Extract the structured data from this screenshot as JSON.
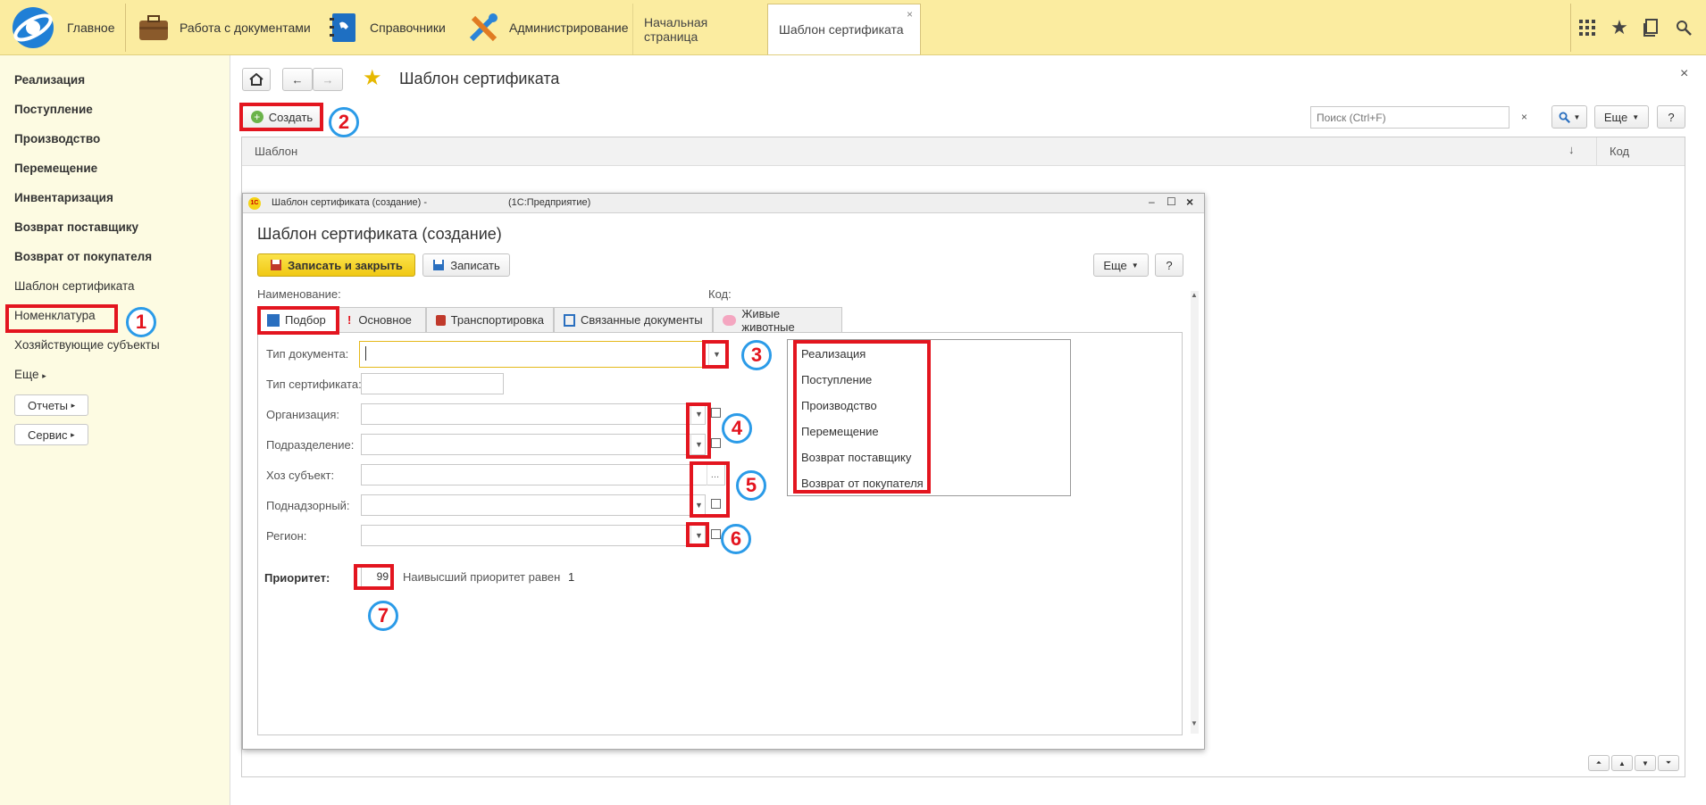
{
  "topbar": {
    "home": "Главное",
    "docs": "Работа с документами",
    "refs": "Справочники",
    "admin": "Администрирование",
    "tab_start": "Начальная страница",
    "tab_template": "Шаблон сертификата"
  },
  "sidebar": {
    "items": [
      "Реализация",
      "Поступление",
      "Производство",
      "Перемещение",
      "Инвентаризация",
      "Возврат поставщику",
      "Возврат от покупателя",
      "Шаблон сертификата",
      "Номенклатура",
      "Хозяйствующие субъекты",
      "Еще"
    ],
    "reports": "Отчеты",
    "service": "Сервис"
  },
  "page": {
    "title": "Шаблон сертификата",
    "create": "Создать",
    "search_placeholder": "Поиск (Ctrl+F)",
    "more": "Еще",
    "help": "?",
    "col_template": "Шаблон",
    "col_code": "Код"
  },
  "dialog": {
    "window_title": "Шаблон сертификата (создание) -",
    "app": "(1С:Предприятие)",
    "heading": "Шаблон сертификата (создание)",
    "save_close": "Записать и закрыть",
    "save": "Записать",
    "more": "Еще",
    "help": "?",
    "name_label": "Наименование:",
    "code_label": "Код:",
    "tabs": [
      "Подбор",
      "Основное",
      "Транспортировка",
      "Связанные документы",
      "Живые животные"
    ],
    "fields": {
      "doc_type": "Тип документа:",
      "cert_type": "Тип сертификата:",
      "org": "Организация:",
      "dept": "Подразделение:",
      "subject": "Хоз субъект:",
      "supervised": "Поднадзорный:",
      "region": "Регион:"
    },
    "priority_label": "Приоритет:",
    "priority_value": "99",
    "highest_label": "Наивысший приоритет равен",
    "highest_value": "1",
    "doc_list": [
      "Реализация",
      "Поступление",
      "Производство",
      "Перемещение",
      "Возврат поставщику",
      "Возврат от покупателя"
    ]
  },
  "markers": [
    "1",
    "2",
    "3",
    "4",
    "5",
    "6",
    "7"
  ],
  "colors": {
    "accent": "#fbeca0",
    "marker_box": "#e3151f",
    "marker_circle": "#2b9be8",
    "primary_btn": "#f5d416"
  }
}
